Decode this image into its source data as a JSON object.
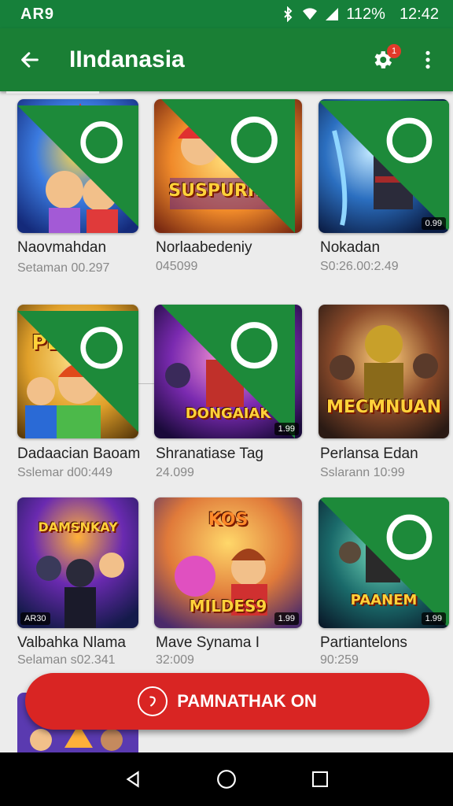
{
  "status_bar": {
    "carrier": "AR9",
    "battery": "112%",
    "time": "12:42"
  },
  "app_bar": {
    "title": "IIndanasia",
    "badge": "1"
  },
  "cards": [
    {
      "title": "Naovmahdan",
      "subtitle": "Setaman 00.297",
      "thumb_text": "",
      "age_label": ""
    },
    {
      "title": "Norlaabedeniy",
      "subtitle": "045099",
      "thumb_text": "SUSPURRAK",
      "age_label": ""
    },
    {
      "title": "Nokadan",
      "subtitle": "S0:26.00:2.49",
      "thumb_text": "",
      "age_label": "0.99"
    },
    {
      "title": "Dadaacian Baoam",
      "subtitle": "Sslemar d00:449",
      "thumb_text": "PLAOEN",
      "age_label": ""
    },
    {
      "title": "Shranatiase Tag",
      "subtitle": "24.099",
      "thumb_text": "DONGAIAK",
      "age_label": "1.99"
    },
    {
      "title": "Perlansa Edan",
      "subtitle": "Sslarann 10:99",
      "thumb_text": "MECMNUAN",
      "age_label": ""
    },
    {
      "title": "Valbahka Nlama",
      "subtitle": "Selaman s02.341",
      "thumb_text": "DAMSNKAY",
      "age_label": "AR30"
    },
    {
      "title": "Mave Synama  I",
      "subtitle": "32:009",
      "thumb_text": "MILDES9",
      "age_label": "1.99"
    },
    {
      "title": "Partiantelons",
      "subtitle": "90:259",
      "thumb_text": "PAANEM",
      "age_label": "1.99"
    }
  ],
  "cta": {
    "label": "PAMNATHAK ON"
  },
  "colors": {
    "primary": "#1a7f35",
    "accent": "#d92523"
  }
}
